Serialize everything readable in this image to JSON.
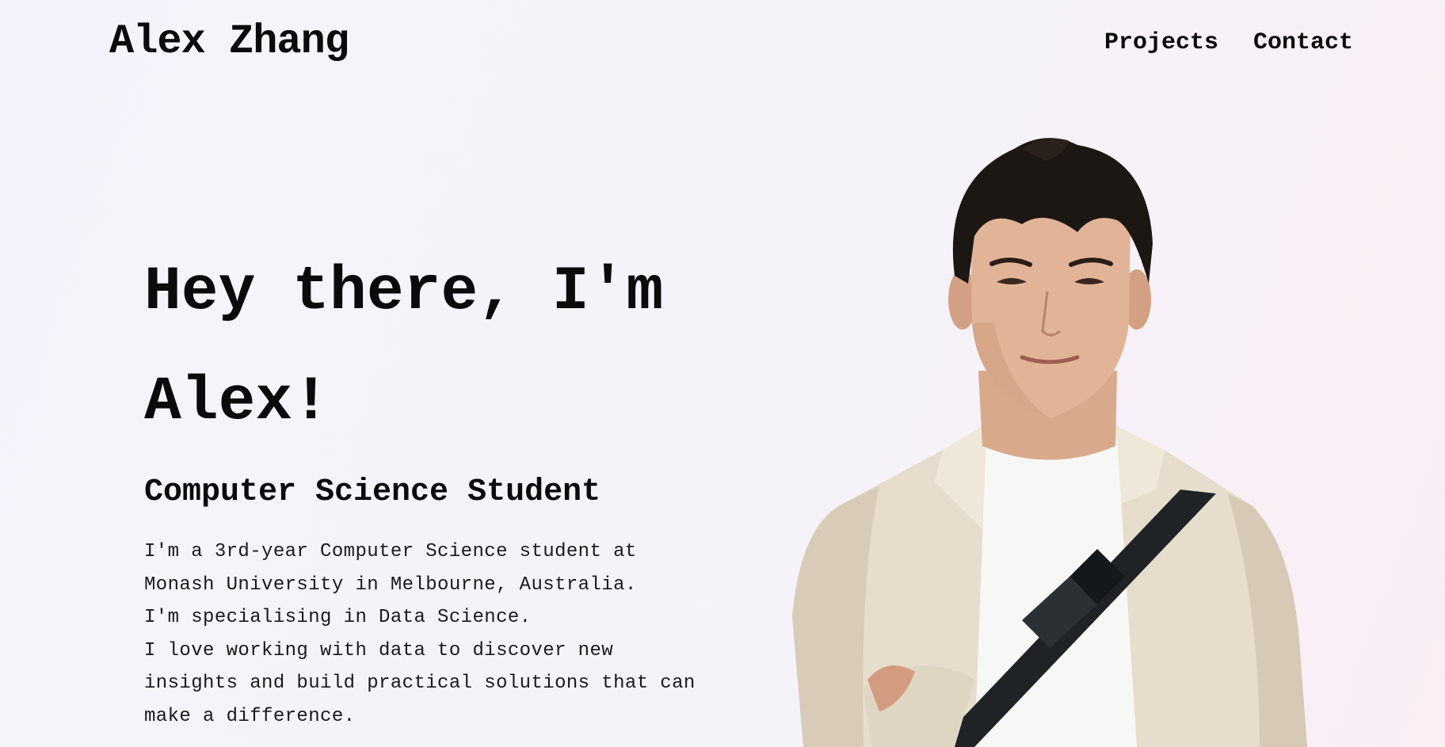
{
  "header": {
    "brand": "Alex Zhang",
    "nav": [
      {
        "label": "Projects"
      },
      {
        "label": "Contact"
      }
    ]
  },
  "hero": {
    "title_line1": "Hey there, I'm",
    "title_line2": "Alex!",
    "subtitle": "Computer Science Student",
    "description": [
      "I'm a 3rd-year Computer Science student at",
      "Monash University in Melbourne, Australia.",
      "I'm specialising in Data Science.",
      "I love working with data to discover new",
      "insights and build practical solutions that can",
      "make a difference."
    ]
  },
  "colors": {
    "background_start": "#f3f4fb",
    "background_end": "#fbeef5",
    "text": "#0b0b0b"
  }
}
